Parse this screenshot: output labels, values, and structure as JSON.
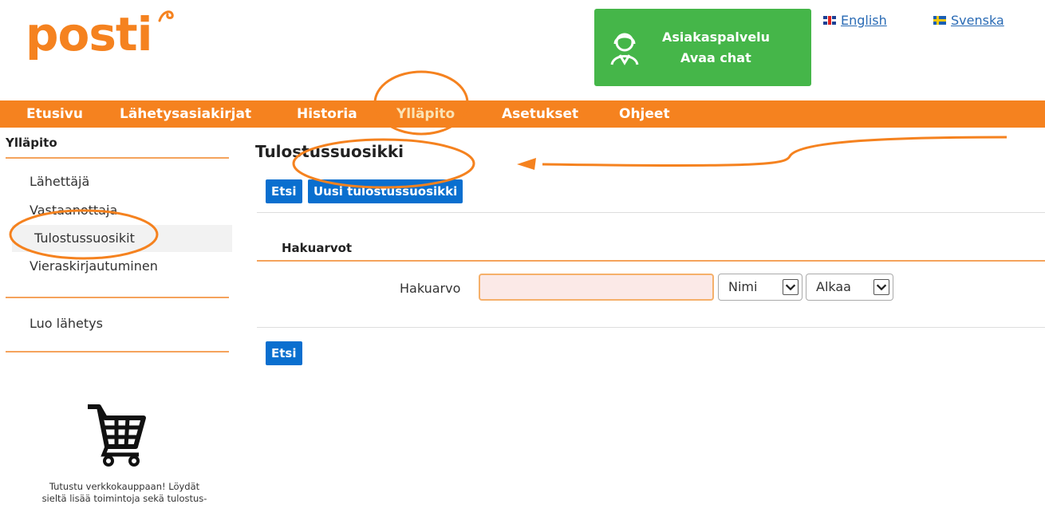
{
  "header": {
    "logo_text": "posti",
    "chat": {
      "line1": "Asiakaspalvelu",
      "line2": "Avaa chat"
    },
    "languages": [
      {
        "label": "English",
        "flag": "gb-flag-icon"
      },
      {
        "label": "Svenska",
        "flag": "se-flag-icon"
      }
    ]
  },
  "nav": {
    "items": [
      "Etusivu",
      "Lähetysasiakirjat",
      "Historia",
      "Ylläpito",
      "Asetukset",
      "Ohjeet"
    ],
    "active": "Ylläpito"
  },
  "sidebar": {
    "title": "Ylläpito",
    "items": [
      "Lähettäjä",
      "Vastaanottaja",
      "Tulostussuosikit",
      "Vieraskirjautuminen"
    ],
    "selected": "Tulostussuosikit",
    "create_label": "Luo lähetys",
    "promo": {
      "icon": "shopping-cart-icon",
      "line1": "Tutustu verkkokauppaan! Löydät",
      "line2": "sieltä lisää toimintoja sekä tulostus-"
    }
  },
  "main": {
    "title": "Tulostussuosikki",
    "search_button": "Etsi",
    "new_button": "Uusi tulostussuosikki",
    "section_title": "Hakuarvot",
    "field_label": "Hakuarvo",
    "field_value": "",
    "select_field": "Nimi",
    "select_mode": "Alkaa",
    "bottom_button": "Etsi"
  },
  "colors": {
    "brand_orange": "#f5821f",
    "chat_green": "#45b649",
    "button_blue": "#0a6fcf",
    "annotation": "#f5821f"
  }
}
